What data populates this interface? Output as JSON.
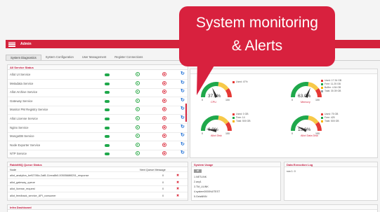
{
  "header": {
    "title": "Admin"
  },
  "tabs": [
    "System Diagnostics",
    "System Configuration",
    "User Management",
    "Register Connections"
  ],
  "services_panel": {
    "title": "All Service Status",
    "items": [
      "Allot UI Service",
      "Metadata Service",
      "Allot Archive Service",
      "Gateway Service",
      "Monitor PM Registry Service",
      "Allot License Service",
      "Nginx Service",
      "MongoDB Service",
      "Node Exporter Service",
      "NTP Service"
    ]
  },
  "gauges": [
    {
      "value": "37.0%",
      "label": "CPU",
      "min": "0",
      "max": "100",
      "legend": [
        "Used: 47%"
      ]
    },
    {
      "value": "63.0%",
      "label": "Memory",
      "min": "0",
      "max": "100",
      "legend": [
        "Used: 17.34 GB",
        "Free: 11.25 GB",
        "Buffer: 4.54 GB",
        "Total: 30.39 GB"
      ]
    },
    {
      "value": "6.0%",
      "label": "Allot Disk",
      "min": "0",
      "max": "100",
      "legend": [
        "Used: 0 GB",
        "Free: 14",
        "Total: 500 GB"
      ]
    },
    {
      "value": "15.0%",
      "label": "Allot Data Disk",
      "min": "0",
      "max": "100",
      "legend": [
        "Used: 75 GB",
        "Free: 425",
        "Total: 500 GB"
      ]
    }
  ],
  "queue_panel": {
    "title": "RabbitMQ Queue Status",
    "col_node": "Node",
    "col_count": "Next Queue Message",
    "rows": [
      {
        "name": "allot_analytics_be92786c-2af8-11eea8b0-0050568f8251_response",
        "count": "0"
      },
      {
        "name": "allot_gateway_queue",
        "count": "0"
      },
      {
        "name": "allot_license_request",
        "count": "0"
      },
      {
        "name": "allot_feedback_service_API_consumer",
        "count": "0"
      }
    ]
  },
  "usage_panel": {
    "title": "System Usage",
    "button": "all",
    "items": [
      "1.NETLINK",
      "2.any1",
      "3.TM_ULINK",
      "4.system0000N4/TEST",
      "5.GetaNNN"
    ]
  },
  "log_panel": {
    "title": "Data Execution Log",
    "text": "row 1: 0"
  },
  "dashboard": {
    "title": "Infra Dashboard"
  },
  "callout": {
    "line1": "System monitoring",
    "line2": "& Alerts"
  },
  "colors": {
    "brand": "#d3233c",
    "ok": "#1fa84b",
    "callout": "#d8213e"
  }
}
